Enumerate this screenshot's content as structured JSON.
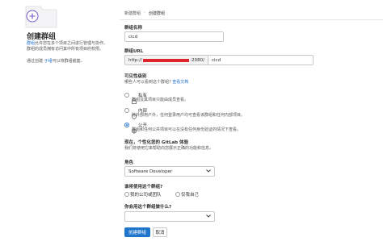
{
  "breadcrumb": {
    "first": "新建群组",
    "separator": "›",
    "current": "创建群组"
  },
  "sidebar": {
    "title": "创建群组",
    "desc_link": "群组",
    "desc_line1": "允许您在多个项目之间进行管理与协作。",
    "desc_line2": "群组的成员拥有访问其中所有项目的权限。",
    "import_prefix": "通过创建",
    "import_link": "子组",
    "import_suffix": "可以将群组嵌套。"
  },
  "form": {
    "group_name_label": "群组名称",
    "group_name_value": "cicd",
    "group_url_label": "群组URL",
    "group_url_prefix": "http://",
    "group_url_port": ":2080/",
    "group_url_path": "cicd",
    "visibility_title": "可见性级别",
    "visibility_question": "哪些人可以看到这个群组?",
    "visibility_link": "查看文档",
    "visibility_options": [
      {
        "label": "私有",
        "desc": "群组及其项目只能由成员查看。",
        "selected": false
      },
      {
        "label": "内部",
        "desc": "除外部用户外，任何登录用户均可查看该群组和任何内部项目。",
        "selected": false
      },
      {
        "label": "公开",
        "desc": "群组和任何公共项目可以在没有任何身份验证的情况下查看。",
        "selected": true
      }
    ],
    "personalize_title": "现在，个性化您的 GitLab 体验",
    "personalize_desc": "我们将使用它来帮助向您展示正确的功能和信息。",
    "role_label": "角色",
    "role_value": "Software Developer",
    "who_label": "谁将使用这个群组?",
    "who_options": [
      {
        "label": "我的公司或团队",
        "selected": false
      },
      {
        "label": "仅我自己",
        "selected": false
      }
    ],
    "purpose_label": "你会用这个群组做什么?",
    "purpose_value": "",
    "submit_label": "创建群组",
    "cancel_label": "取消"
  },
  "colors": {
    "primary": "#1f75cb",
    "redact": "#e0242c",
    "link": "#1f6fd1"
  }
}
